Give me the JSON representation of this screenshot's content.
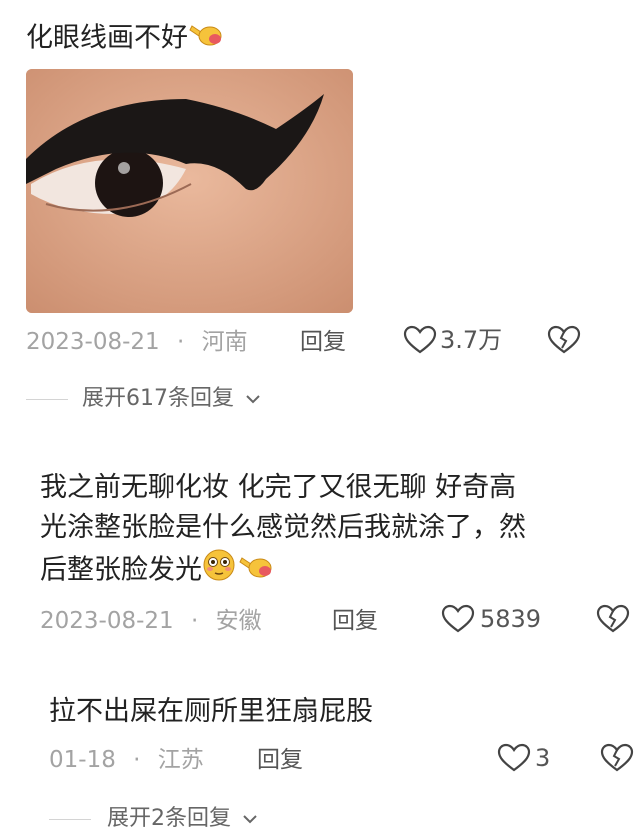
{
  "comments": [
    {
      "text_lines": [
        "化眼线画不好"
      ],
      "emoji": "pointing-hand-emoji",
      "date": "2023-08-21",
      "separator": "·",
      "location": "河南",
      "reply_label": "回复",
      "likes": "3.7万",
      "expand_label": "展开617条回复"
    },
    {
      "text_lines": [
        "我之前无聊化妆  化完了又很无聊  好奇高",
        "光涂整张脸是什么感觉然后我就涂了，然",
        "后整张脸发光"
      ],
      "date": "2023-08-21",
      "separator": "·",
      "location": "安徽",
      "reply_label": "回复",
      "likes": "5839"
    },
    {
      "text_lines": [
        "拉不出屎在厕所里狂扇屁股"
      ],
      "date": "01-18",
      "separator": "·",
      "location": "江苏",
      "reply_label": "回复",
      "likes": "3",
      "expand_label": "展开2条回复"
    }
  ],
  "colors": {
    "meta": "#a3a3a3",
    "text": "#222222",
    "icon": "#444444"
  }
}
